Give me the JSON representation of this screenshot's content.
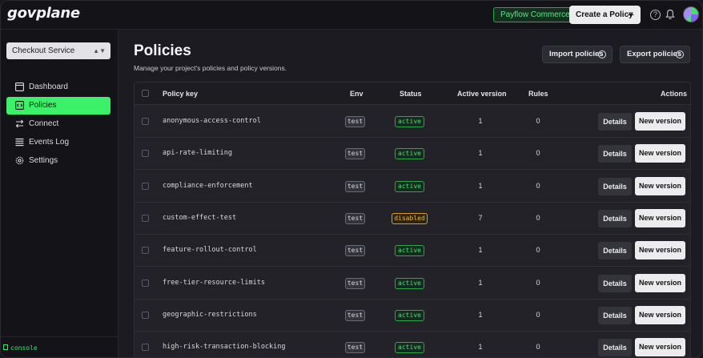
{
  "app": {
    "logo": "govplane"
  },
  "topbar": {
    "org": "Payflow Commerce",
    "create_label": "Create a Policy",
    "create_icon": "+",
    "help_icon": "?",
    "icons": [
      "help-icon",
      "bell-icon",
      "avatar"
    ]
  },
  "sidebar": {
    "project": "Checkout Service",
    "project_chevron": "⌃⌄",
    "items": [
      {
        "label": "Dashboard",
        "icon": "dashboard-icon",
        "active": false
      },
      {
        "label": "Policies",
        "icon": "policies-icon",
        "active": true
      },
      {
        "label": "Connect",
        "icon": "connect-icon",
        "active": false
      },
      {
        "label": "Events Log",
        "icon": "events-icon",
        "active": false
      },
      {
        "label": "Settings",
        "icon": "gear-icon",
        "active": false
      }
    ],
    "footer": "console"
  },
  "main": {
    "title": "Policies",
    "subtitle": "Manage your project's policies and policy versions.",
    "import_label": "Import policies",
    "import_icon": "↓",
    "export_label": "Export policies",
    "export_icon": "↑"
  },
  "table": {
    "headers": {
      "key": "Policy key",
      "env": "Env",
      "status": "Status",
      "version": "Active version",
      "rules": "Rules",
      "actions": "Actions"
    },
    "details_label": "Details",
    "new_version_label": "New version",
    "rows": [
      {
        "key": "anonymous-access-control",
        "env": "test",
        "status": "active",
        "version": "1",
        "rules": "0"
      },
      {
        "key": "api-rate-limiting",
        "env": "test",
        "status": "active",
        "version": "1",
        "rules": "0"
      },
      {
        "key": "compliance-enforcement",
        "env": "test",
        "status": "active",
        "version": "1",
        "rules": "0"
      },
      {
        "key": "custom-effect-test",
        "env": "test",
        "status": "disabled",
        "version": "7",
        "rules": "0"
      },
      {
        "key": "feature-rollout-control",
        "env": "test",
        "status": "active",
        "version": "1",
        "rules": "0"
      },
      {
        "key": "free-tier-resource-limits",
        "env": "test",
        "status": "active",
        "version": "1",
        "rules": "0"
      },
      {
        "key": "geographic-restrictions",
        "env": "test",
        "status": "active",
        "version": "1",
        "rules": "0"
      },
      {
        "key": "high-risk-transaction-blocking",
        "env": "test",
        "status": "active",
        "version": "1",
        "rules": "0"
      }
    ]
  }
}
